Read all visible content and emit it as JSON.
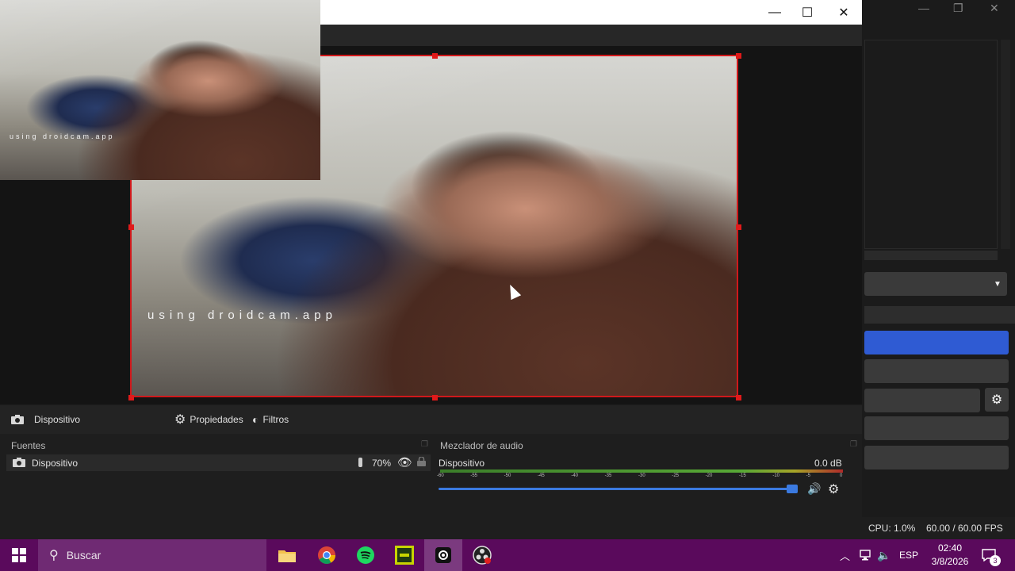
{
  "front_window": {
    "min_label": "—",
    "max_label": "☐",
    "close_label": "✕"
  },
  "background_window": {
    "min_label": "—",
    "restore_label": "❐",
    "close_label": "✕"
  },
  "preview": {
    "watermark_main": "using droidcam.app",
    "watermark_pip": "using droidcam.app",
    "selection_color": "#d0181b"
  },
  "context_bar": {
    "source_name": "Dispositivo",
    "properties_label": "Propiedades",
    "filters_label": "Filtros"
  },
  "sources": {
    "title": "Fuentes",
    "items": [
      {
        "name": "Dispositivo",
        "opacity": "70%"
      }
    ]
  },
  "mixer": {
    "title": "Mezclador de audio",
    "channel_name": "Dispositivo",
    "level": "0.0 dB",
    "ticks": [
      "-60",
      "-55",
      "-50",
      "-45",
      "-40",
      "-35",
      "-30",
      "-25",
      "-20",
      "-15",
      "-10",
      "-5",
      "0"
    ],
    "volume_fraction": 0.98
  },
  "status": {
    "cpu": "CPU: 1.0%",
    "fps": "60.00 / 60.00 FPS"
  },
  "right_dock": {
    "dropdown_arrow": "▼",
    "gear": "⚙"
  },
  "taskbar": {
    "search_placeholder": "Buscar",
    "language": "ESP",
    "time": "02:40",
    "date": "3/8/2026",
    "notifications": "3",
    "accent": "#5a0a5c"
  }
}
